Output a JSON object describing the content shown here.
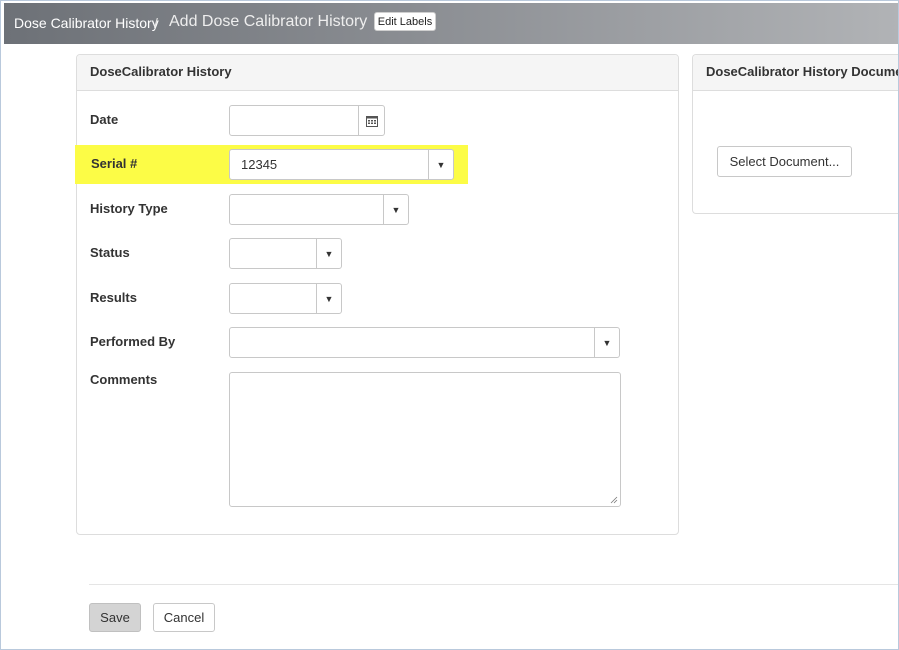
{
  "header": {
    "breadcrumb_root": "Dose Calibrator History",
    "separator": "/",
    "breadcrumb_current": "Add Dose Calibrator History",
    "edit_labels": "Edit Labels"
  },
  "form_panel": {
    "title": "DoseCalibrator History",
    "fields": {
      "date": {
        "label": "Date",
        "value": ""
      },
      "serial": {
        "label": "Serial #",
        "value": "12345"
      },
      "history_type": {
        "label": "History Type",
        "value": ""
      },
      "status": {
        "label": "Status",
        "value": ""
      },
      "results": {
        "label": "Results",
        "value": ""
      },
      "performed_by": {
        "label": "Performed By",
        "value": ""
      },
      "comments": {
        "label": "Comments",
        "value": ""
      }
    },
    "highlight_color": "#fcfc46"
  },
  "document_panel": {
    "title": "DoseCalibrator History Documents",
    "select_button": "Select Document..."
  },
  "footer": {
    "save": "Save",
    "cancel": "Cancel"
  },
  "icons": {
    "calendar": "calendar-icon",
    "dropdown": "caret-down-icon",
    "resize": "resize-handle-icon"
  }
}
